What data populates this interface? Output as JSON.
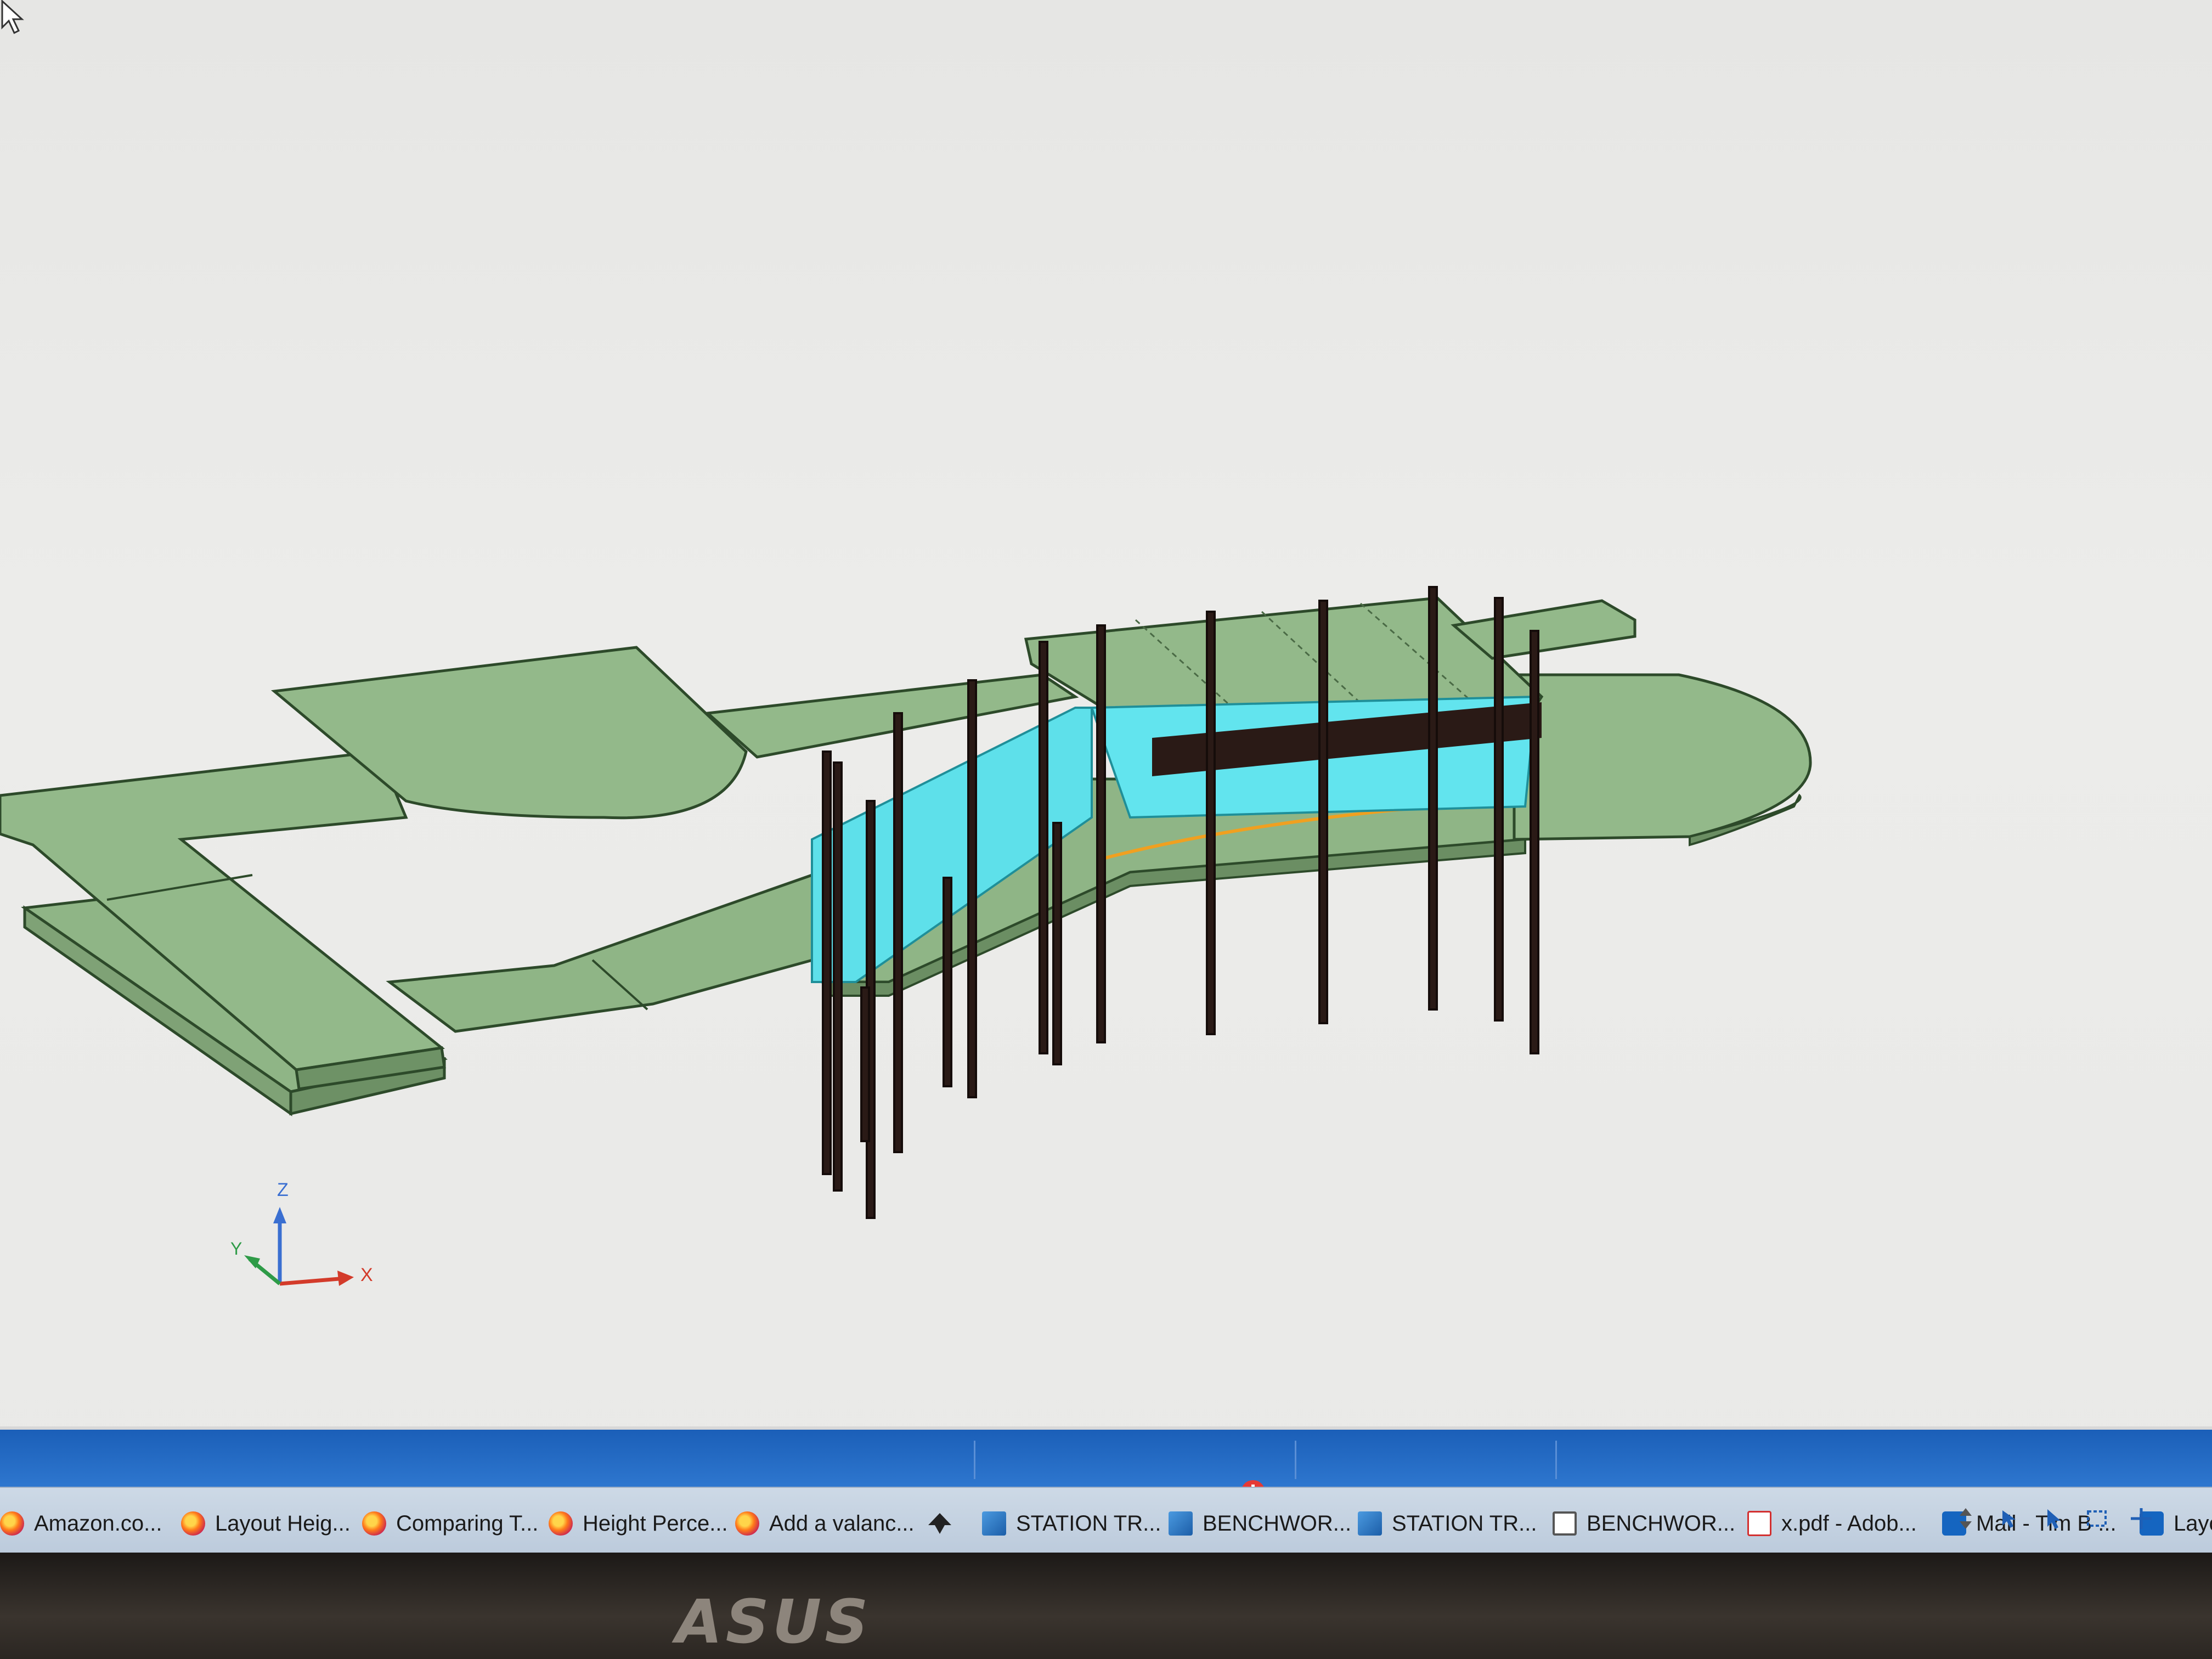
{
  "axes": {
    "x": "X",
    "y": "Y",
    "z": "Z"
  },
  "taskbar": {
    "items": [
      {
        "label": "Amazon.co...",
        "icon": "firefox-icon"
      },
      {
        "label": "Layout Heig...",
        "icon": "firefox-icon"
      },
      {
        "label": "Comparing T...",
        "icon": "firefox-icon"
      },
      {
        "label": "Height Perce...",
        "icon": "firefox-icon"
      },
      {
        "label": "Add a valanc...",
        "icon": "firefox-icon"
      },
      {
        "label": "",
        "icon": "app-icon"
      },
      {
        "label": "STATION TR...",
        "icon": "cad-icon"
      },
      {
        "label": "BENCHWOR...",
        "icon": "cad-icon"
      },
      {
        "label": "STATION TR...",
        "icon": "cad-icon"
      },
      {
        "label": "BENCHWOR...",
        "icon": "cube-icon"
      },
      {
        "label": "x.pdf - Adob...",
        "icon": "pdf-icon"
      },
      {
        "label": "Mail - Tim B ...",
        "icon": "outlook-icon"
      },
      {
        "label": "Layo",
        "icon": "app-icon"
      }
    ]
  },
  "monitor": {
    "brand": "ASUS"
  },
  "colors": {
    "deck": "#8fb586",
    "wall": "#5ee0ea",
    "post": "#2a1a16",
    "taskbar": "#c5d3e2",
    "statusbar": "#1f63bb"
  }
}
